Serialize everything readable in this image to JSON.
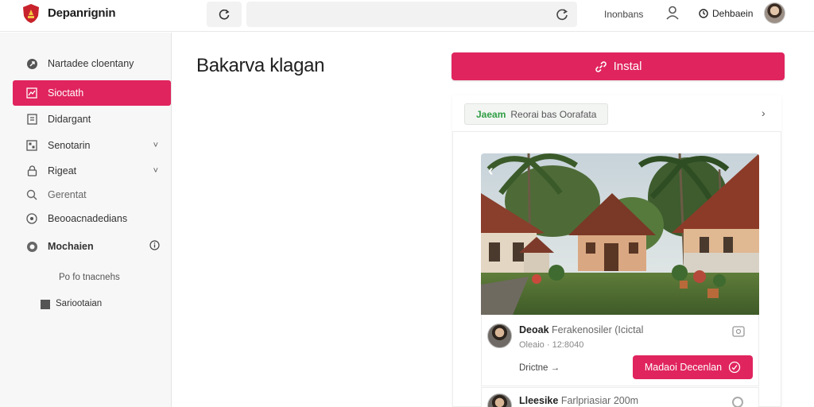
{
  "header": {
    "brand": "Depanrignin",
    "search_value": "",
    "top_link": "Inonbans",
    "settings_label": "Dehbaein"
  },
  "sidebar": {
    "items": [
      {
        "label": "Nartadee cloentany",
        "icon": "rocket-icon"
      },
      {
        "label": "Sioctath",
        "icon": "chart-icon",
        "active": true
      },
      {
        "label": "Didargant",
        "icon": "document-icon"
      },
      {
        "label": "Senotarin",
        "icon": "grid-icon",
        "chevron": "˅"
      },
      {
        "label": "Rigeat",
        "icon": "lock-icon",
        "chevron": "˅"
      },
      {
        "label": "Gerentat",
        "icon": "search-icon"
      },
      {
        "label": "Beooacnadedians",
        "icon": "target-icon"
      },
      {
        "label": "Mochaien",
        "icon": "shield-icon",
        "badge_icon": "info-icon"
      }
    ],
    "sub_items": [
      {
        "label": "Po fo tnacnehs"
      },
      {
        "label": "Sariootaian"
      }
    ]
  },
  "main": {
    "title": "Bakarva klagan",
    "install_label": "Instal",
    "filter_tag_prefix": "Jaeam",
    "filter_tag_text": "Reorai bas Oorafata",
    "listing": {
      "name": "Deoak",
      "name_rest": "Ferakenosiler",
      "name_suffix": "(Icictal",
      "meta": "Oleaio · 12:8040",
      "state": "Drictne →",
      "action_label": "Madaoi Decenlan"
    },
    "listing2": {
      "name": "Lleesike",
      "name_rest": "Farlpriasiar  200m"
    }
  },
  "colors": {
    "accent": "#e0245e",
    "tag_green": "#2f9e44"
  }
}
